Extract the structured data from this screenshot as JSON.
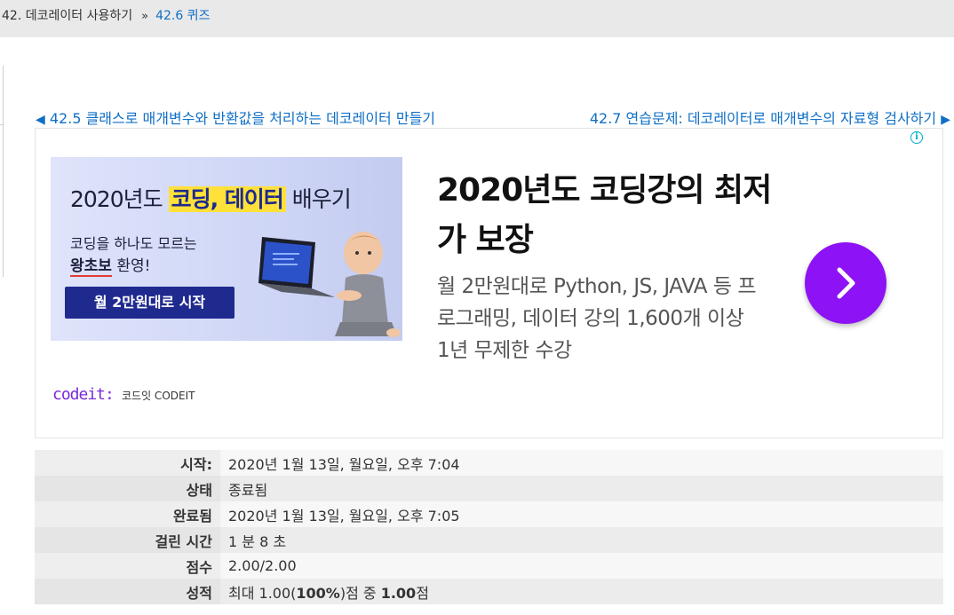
{
  "breadcrumb": {
    "parent": "42. 데코레이터 사용하기",
    "separator": "»",
    "current": "42.6 퀴즈"
  },
  "nav": {
    "prev_arrow": "◀",
    "prev_label": "42.5 클래스로 매개변수와 반환값을 처리하는 데코레이터 만들기",
    "next_label": "42.7 연습문제: 데코레이터로 매개변수의 자료형 검사하기",
    "next_arrow": "▶"
  },
  "ad": {
    "info_icon": "i",
    "banner": {
      "title_pre": "2020년도 ",
      "title_highlight": "코딩, 데이터",
      "title_post": " 배우기",
      "sub_line1": "코딩을 하나도 모르는",
      "sub_line2_underlined": "왕초보",
      "sub_line2_rest": " 환영!",
      "cta": "월 2만원대로 시작"
    },
    "logo_text": "codeit:",
    "brand": "코드잇 CODEIT",
    "headline": "2020년도 코딩강의 최저가 보장",
    "body": "월 2만원대로 Python, JS, JAVA 등 프로그래밍, 데이터 강의 1,600개 이상 1년 무제한 수강",
    "accent_color": "#8d12f5"
  },
  "summary": {
    "rows": [
      {
        "label": "시작:",
        "value": "2020년 1월 13일, 월요일, 오후 7:04"
      },
      {
        "label": "상태",
        "value": "종료됨"
      },
      {
        "label": "완료됨",
        "value": "2020년 1월 13일, 월요일, 오후 7:05"
      },
      {
        "label": "걸린 시간",
        "value": "1 분 8 초"
      },
      {
        "label": "점수",
        "value": "2.00/2.00"
      },
      {
        "label": "성적",
        "value_pre": "최대 1.00(",
        "value_bold1": "100%",
        "value_mid": ")점 중 ",
        "value_bold2": "1.00",
        "value_post": "점"
      }
    ]
  }
}
